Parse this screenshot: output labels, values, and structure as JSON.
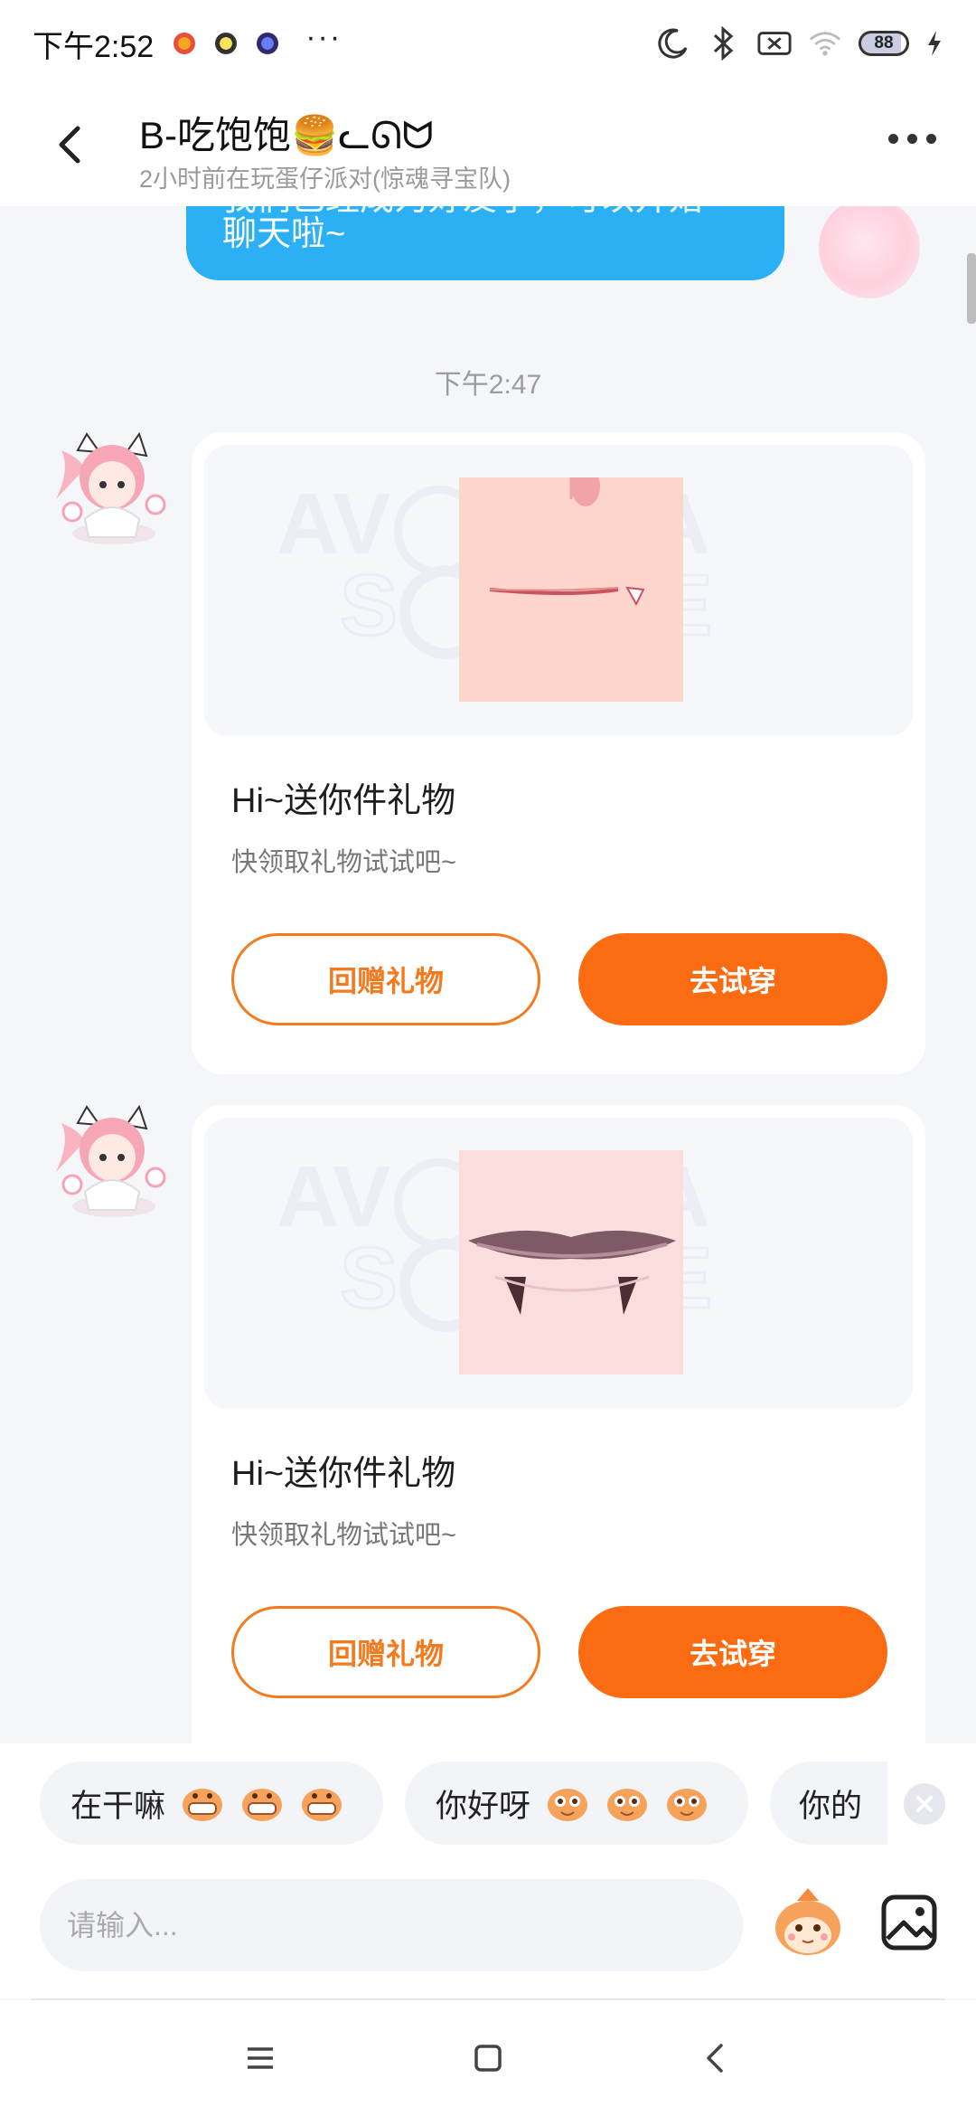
{
  "status_bar": {
    "time": "下午2:52",
    "more": "···",
    "battery": "88"
  },
  "header": {
    "title": "B-吃饱饱🍔ᓚᘏᗢ",
    "subtitle": "2小时前在玩蛋仔派对(惊魂寻宝队)"
  },
  "chat": {
    "sent_bubble": {
      "line1": "我们已经成为好友了，可以开始",
      "line2": "聊天啦~"
    },
    "timestamp": "下午2:47",
    "messages": [
      {
        "title": "Hi~送你件礼物",
        "subtitle": "快领取礼物试试吧~",
        "return_gift_label": "回赠礼物",
        "try_on_label": "去试穿"
      },
      {
        "title": "Hi~送你件礼物",
        "subtitle": "快领取礼物试试吧~",
        "return_gift_label": "回赠礼物",
        "try_on_label": "去试穿"
      }
    ]
  },
  "quick_replies": [
    {
      "text": "在干嘛"
    },
    {
      "text": "你好呀"
    },
    {
      "text": "你的"
    }
  ],
  "input": {
    "placeholder": "请输入..."
  },
  "colors": {
    "accent_orange": "#fb6c12",
    "sent_bubble_blue": "#2bb0f5",
    "background": "#f5f6fa"
  },
  "icons": [
    "back-icon",
    "more-icon",
    "moon-icon",
    "bluetooth-icon",
    "sim-off-icon",
    "wifi-icon",
    "battery-icon",
    "charging-icon",
    "mascot-emoji-icon",
    "image-icon",
    "close-icon",
    "menu-icon",
    "home-icon",
    "nav-back-icon"
  ]
}
